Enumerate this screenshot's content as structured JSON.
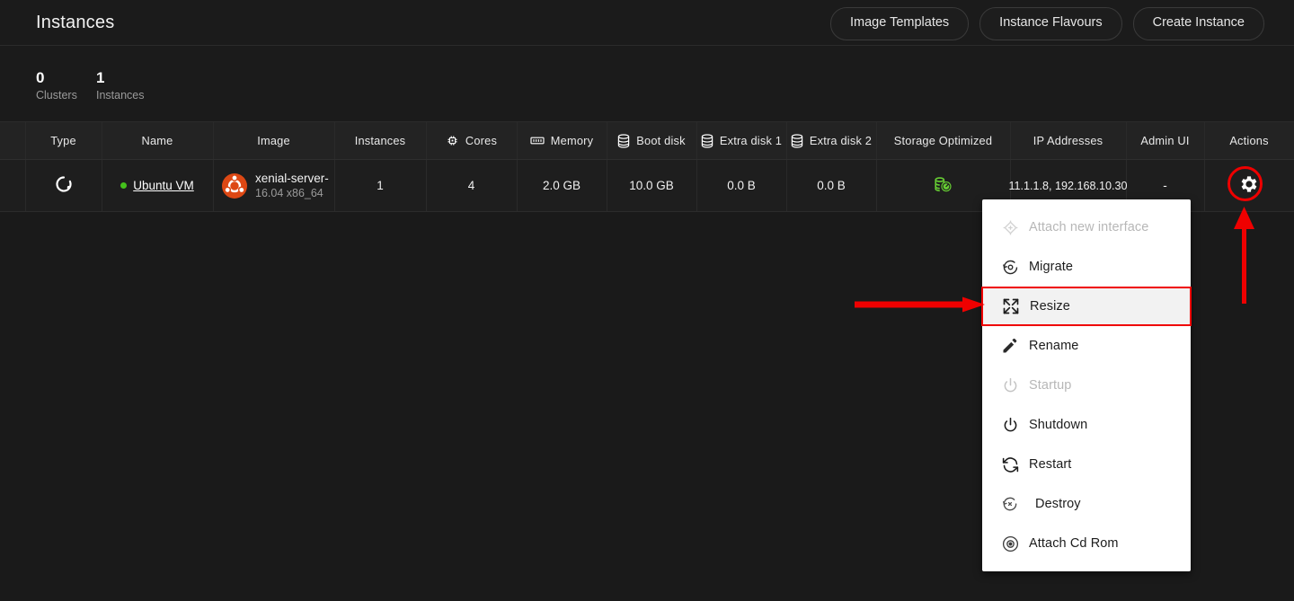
{
  "header": {
    "title": "Instances",
    "buttons": [
      {
        "label": "Image Templates",
        "name": "image-templates-button"
      },
      {
        "label": "Instance Flavours",
        "name": "instance-flavours-button"
      },
      {
        "label": "Create Instance",
        "name": "create-instance-button"
      }
    ]
  },
  "stats": [
    {
      "value": "0",
      "label": "Clusters"
    },
    {
      "value": "1",
      "label": "Instances"
    }
  ],
  "table": {
    "columns": [
      {
        "label": "Type",
        "icon": null
      },
      {
        "label": "Name",
        "icon": null
      },
      {
        "label": "Image",
        "icon": null
      },
      {
        "label": "Instances",
        "icon": null
      },
      {
        "label": "Cores",
        "icon": "cpu-icon"
      },
      {
        "label": "Memory",
        "icon": "memory-icon"
      },
      {
        "label": "Boot disk",
        "icon": "disk-icon"
      },
      {
        "label": "Extra disk 1",
        "icon": "disk-icon"
      },
      {
        "label": "Extra disk 2",
        "icon": "disk-icon"
      },
      {
        "label": "Storage Optimized",
        "icon": null
      },
      {
        "label": "IP Addresses",
        "icon": null
      },
      {
        "label": "Admin UI",
        "icon": null
      },
      {
        "label": "Actions",
        "icon": null
      }
    ],
    "row": {
      "type_icon": "spinner-icon",
      "status_color": "#44c01c",
      "name": "Ubuntu VM",
      "image_icon": "ubuntu-logo-icon",
      "image_name": "xenial-server-",
      "image_version": "16.04 x86_64",
      "instances": "1",
      "cores": "4",
      "memory": "2.0 GB",
      "boot_disk": "10.0 GB",
      "extra_disk_1": "0.0 B",
      "extra_disk_2": "0.0 B",
      "storage_optimized_icon": "storage-optimized-icon",
      "storage_optimized_color": "#66cc33",
      "ip_addresses": "11.1.1.8, 192.168.10.30",
      "admin_ui": "-",
      "actions_icon": "gear-icon"
    }
  },
  "actions_menu": {
    "items": [
      {
        "label": "Attach new interface",
        "icon": "network-interface-icon",
        "disabled": true,
        "highlighted": false
      },
      {
        "label": "Migrate",
        "icon": "migrate-icon",
        "disabled": false,
        "highlighted": false
      },
      {
        "label": "Resize",
        "icon": "resize-icon",
        "disabled": false,
        "highlighted": true
      },
      {
        "label": "Rename",
        "icon": "pencil-icon",
        "disabled": false,
        "highlighted": false
      },
      {
        "label": "Startup",
        "icon": "power-icon",
        "disabled": true,
        "highlighted": false
      },
      {
        "label": "Shutdown",
        "icon": "power-icon",
        "disabled": false,
        "highlighted": false
      },
      {
        "label": "Restart",
        "icon": "restart-icon",
        "disabled": false,
        "highlighted": false
      },
      {
        "label": "Destroy",
        "icon": "destroy-icon",
        "disabled": false,
        "highlighted": false
      },
      {
        "label": "Attach Cd Rom",
        "icon": "cd-rom-icon",
        "disabled": false,
        "highlighted": false
      }
    ]
  },
  "annotations": {
    "highlight_color": "#ef0000",
    "gear_circle": "gear-icon-highlight-circle",
    "arrow_to_resize": "arrow-pointing-to-resize",
    "arrow_to_gear": "arrow-pointing-to-gear"
  }
}
